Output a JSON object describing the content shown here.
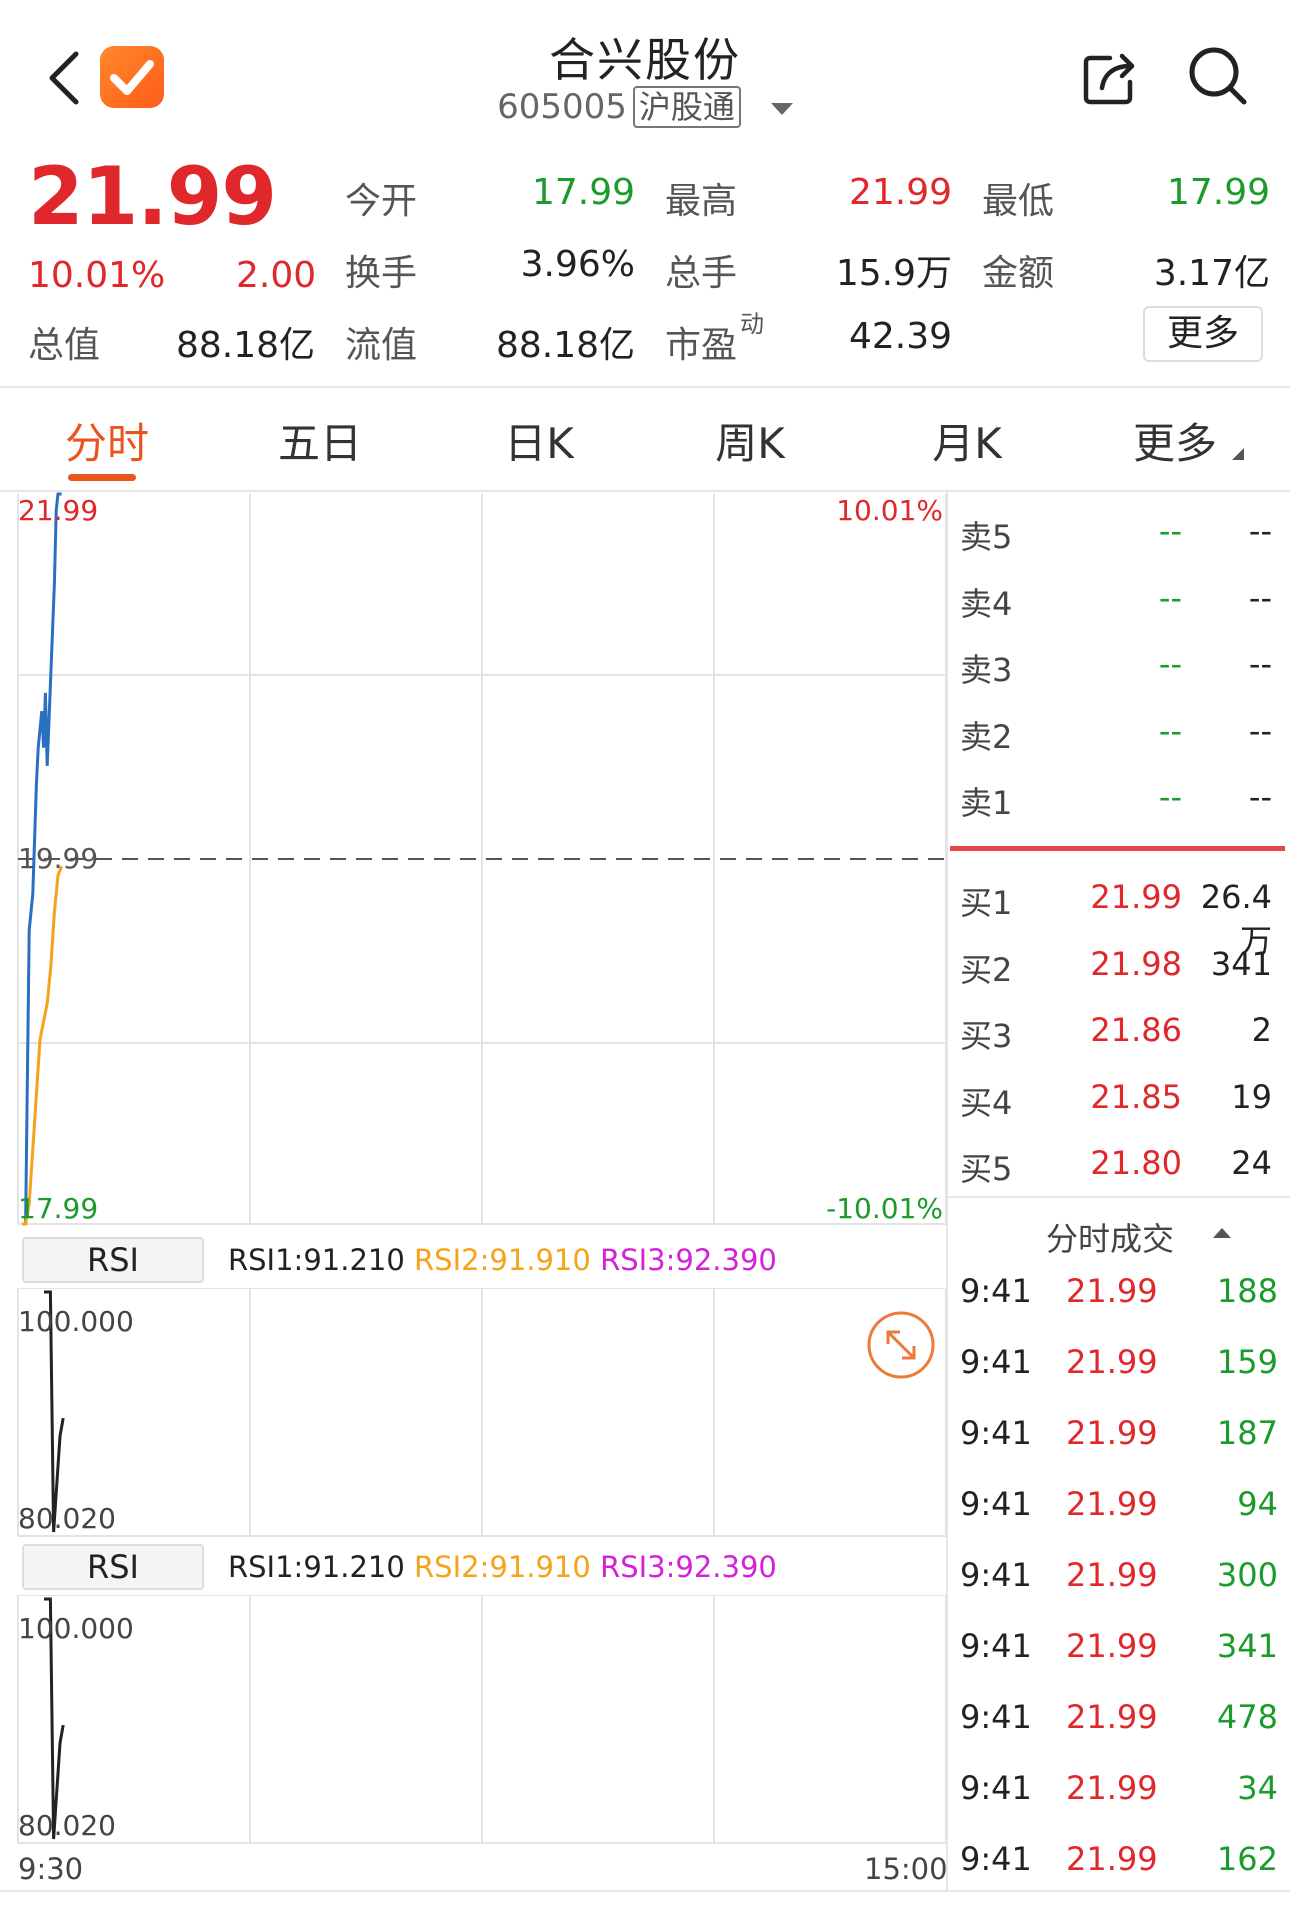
{
  "header": {
    "title": "合兴股份",
    "code": "605005",
    "tag": "沪股通"
  },
  "quote": {
    "price": "21.99",
    "change_pct": "10.01%",
    "change": "2.00",
    "open_label": "今开",
    "open": "17.99",
    "high_label": "最高",
    "high": "21.99",
    "low_label": "最低",
    "low": "17.99",
    "turnover_label": "换手",
    "turnover": "3.96%",
    "volume_label": "总手",
    "volume": "15.9万",
    "amount_label": "金额",
    "amount": "3.17亿",
    "mktcap_label": "总值",
    "mktcap": "88.18亿",
    "float_label": "流值",
    "float": "88.18亿",
    "pe_label": "市盈",
    "pe_sup": "动",
    "pe": "42.39",
    "more_label": "更多"
  },
  "tabs": [
    {
      "label": "分时"
    },
    {
      "label": "五日"
    },
    {
      "label": "日K"
    },
    {
      "label": "周K"
    },
    {
      "label": "月K"
    },
    {
      "label": "更多"
    }
  ],
  "chart_data": [
    {
      "type": "line",
      "title": "",
      "y_labels": {
        "top": "21.99",
        "mid": "19.99",
        "bottom": "17.99",
        "top_right": "10.01%",
        "bottom_right": "-10.01%"
      },
      "ylim": [
        17.99,
        21.99
      ],
      "x_start_label": "9:30",
      "x_end_label": "15:00",
      "series": [
        {
          "color": "#2b6fc0",
          "x": [
            0,
            0.3,
            1,
            2,
            3,
            4,
            4.5,
            5,
            5.5,
            6,
            6.5,
            7,
            8,
            9,
            9.5,
            10,
            11
          ],
          "values": [
            17.99,
            17.99,
            17.99,
            19.6,
            19.8,
            20.4,
            20.6,
            20.7,
            20.8,
            20.6,
            20.9,
            20.5,
            21.0,
            21.5,
            21.9,
            21.99,
            21.99
          ]
        },
        {
          "color": "#f4a31a",
          "x": [
            0,
            1,
            2,
            3,
            4,
            5,
            6,
            7,
            8,
            9,
            10,
            11
          ],
          "values": [
            17.99,
            17.99,
            18.1,
            18.4,
            18.7,
            19.0,
            19.1,
            19.2,
            19.4,
            19.7,
            19.9,
            19.95
          ]
        }
      ]
    },
    {
      "type": "line",
      "title": "",
      "label": "RSI",
      "legend": [
        "RSI1:91.210",
        "RSI2:91.910",
        "RSI3:92.390"
      ],
      "y_labels": {
        "top": "100.000",
        "bottom": "80.020"
      },
      "ylim": [
        80.02,
        100.0
      ],
      "series": [
        {
          "color": "#222222",
          "x": [
            0,
            1,
            2,
            3,
            4,
            5,
            6
          ],
          "values": [
            100.0,
            100.0,
            100.0,
            80.02,
            84.0,
            88.0,
            89.5
          ]
        }
      ]
    },
    {
      "type": "line",
      "title": "",
      "label": "RSI",
      "legend": [
        "RSI1:91.210",
        "RSI2:91.910",
        "RSI3:92.390"
      ],
      "y_labels": {
        "top": "100.000",
        "bottom": "80.020"
      },
      "ylim": [
        80.02,
        100.0
      ],
      "series": [
        {
          "color": "#222222",
          "x": [
            0,
            1,
            2,
            3,
            4,
            5,
            6
          ],
          "values": [
            100.0,
            100.0,
            100.0,
            80.02,
            84.0,
            88.0,
            89.5
          ]
        }
      ]
    }
  ],
  "orderbook": {
    "sells": [
      {
        "label": "卖5",
        "price": "--",
        "vol": "--"
      },
      {
        "label": "卖4",
        "price": "--",
        "vol": "--"
      },
      {
        "label": "卖3",
        "price": "--",
        "vol": "--"
      },
      {
        "label": "卖2",
        "price": "--",
        "vol": "--"
      },
      {
        "label": "卖1",
        "price": "--",
        "vol": "--"
      }
    ],
    "buys": [
      {
        "label": "买1",
        "price": "21.99",
        "vol": "26.4万"
      },
      {
        "label": "买2",
        "price": "21.98",
        "vol": "341"
      },
      {
        "label": "买3",
        "price": "21.86",
        "vol": "2"
      },
      {
        "label": "买4",
        "price": "21.85",
        "vol": "19"
      },
      {
        "label": "买5",
        "price": "21.80",
        "vol": "24"
      }
    ]
  },
  "trades": {
    "title": "分时成交",
    "rows": [
      {
        "time": "9:41",
        "price": "21.99",
        "vol": "188"
      },
      {
        "time": "9:41",
        "price": "21.99",
        "vol": "159"
      },
      {
        "time": "9:41",
        "price": "21.99",
        "vol": "187"
      },
      {
        "time": "9:41",
        "price": "21.99",
        "vol": "94"
      },
      {
        "time": "9:41",
        "price": "21.99",
        "vol": "300"
      },
      {
        "time": "9:41",
        "price": "21.99",
        "vol": "341"
      },
      {
        "time": "9:41",
        "price": "21.99",
        "vol": "478"
      },
      {
        "time": "9:41",
        "price": "21.99",
        "vol": "34"
      },
      {
        "time": "9:41",
        "price": "21.99",
        "vol": "162"
      }
    ]
  },
  "colors": {
    "up": "#e0272b",
    "down": "#1a9b2b",
    "accent": "#e8561c"
  }
}
